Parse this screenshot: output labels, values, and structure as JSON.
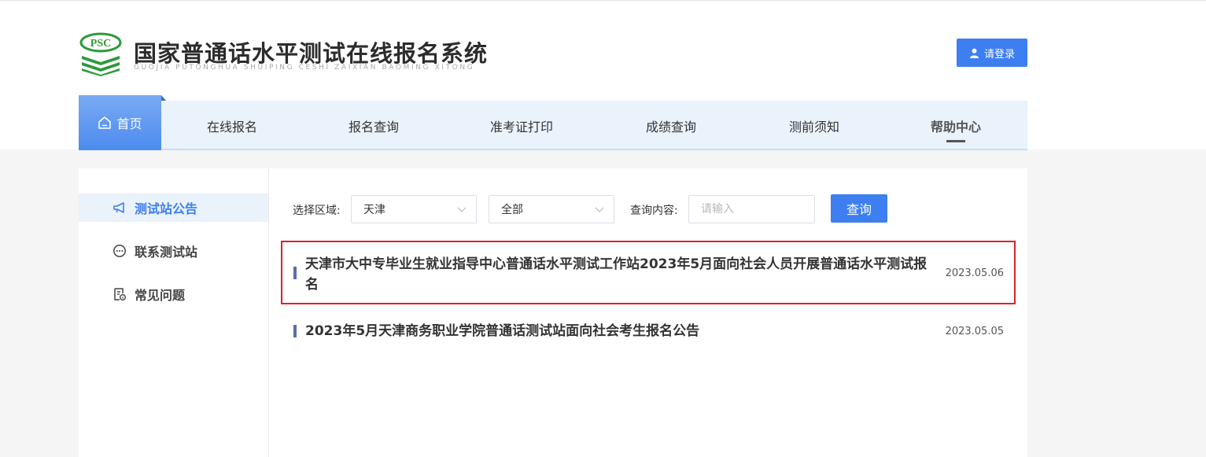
{
  "header": {
    "logo_mark_text": "PSC",
    "title": "国家普通话水平测试在线报名系统",
    "subtitle": "GUOJIA PUTONGHUA SHUIPING CESHI ZAIXIAN BAOMING XITONG",
    "login_label": "请登录"
  },
  "nav": {
    "home_label": "首页",
    "items": [
      {
        "label": "在线报名"
      },
      {
        "label": "报名查询"
      },
      {
        "label": "准考证打印"
      },
      {
        "label": "成绩查询"
      },
      {
        "label": "测前须知"
      },
      {
        "label": "帮助中心"
      }
    ]
  },
  "sidebar": {
    "items": [
      {
        "label": "测试站公告",
        "icon": "megaphone-icon"
      },
      {
        "label": "联系测试站",
        "icon": "chat-bubble-icon"
      },
      {
        "label": "常见问题",
        "icon": "document-question-icon"
      }
    ]
  },
  "filters": {
    "region_label": "选择区域:",
    "region_value": "天津",
    "category_value": "全部",
    "query_label": "查询内容:",
    "query_placeholder": "请输入",
    "query_button": "查询"
  },
  "notices": [
    {
      "title": "天津市大中专毕业生就业指导中心普通话水平测试工作站2023年5月面向社会人员开展普通话水平测试报名",
      "date": "2023.05.06"
    },
    {
      "title": "2023年5月天津商务职业学院普通话测试站面向社会考生报名公告",
      "date": "2023.05.05"
    }
  ],
  "colors": {
    "primary": "#3d7ef1",
    "nav_bg": "#eaf2fc",
    "logo_green": "#2e9a3a",
    "highlight_border": "#d9222a"
  }
}
